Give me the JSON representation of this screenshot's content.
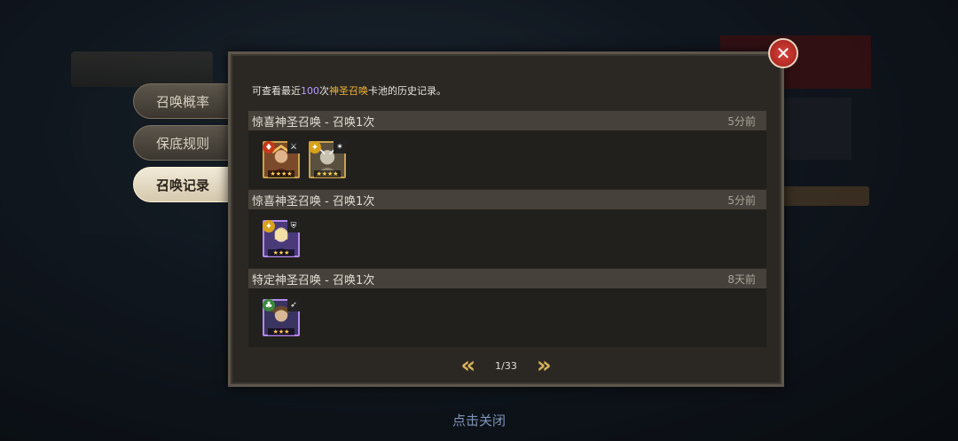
{
  "tabs": [
    {
      "label": "召唤概率",
      "active": false
    },
    {
      "label": "保底规则",
      "active": false
    },
    {
      "label": "召唤记录",
      "active": true
    }
  ],
  "intro": {
    "prefix": "可查看最近",
    "count": "100",
    "mid": "次",
    "pool": "神圣召唤",
    "suffix": "卡池的历史记录。"
  },
  "records": [
    {
      "title": "惊喜神圣召唤 - 召唤1次",
      "time": "5分前",
      "heroes": [
        {
          "frame": "gold",
          "element_icon": "fire-element-icon",
          "class_icon": "sword-class-icon",
          "stars": 4
        },
        {
          "frame": "gold",
          "element_icon": "light-element-icon",
          "class_icon": "star-class-icon",
          "stars": 4
        }
      ]
    },
    {
      "title": "惊喜神圣召唤 - 召唤1次",
      "time": "5分前",
      "heroes": [
        {
          "frame": "purple",
          "element_icon": "light-element-icon",
          "class_icon": "shield-class-icon",
          "stars": 3
        }
      ]
    },
    {
      "title": "特定神圣召唤 - 召唤1次",
      "time": "8天前",
      "heroes": [
        {
          "frame": "purple",
          "element_icon": "earth-element-icon",
          "class_icon": "bow-class-icon",
          "stars": 3
        }
      ]
    }
  ],
  "pager": {
    "label": "1/33"
  },
  "close_hint": "点击关闭",
  "colors": {
    "highlight_count": "#b89cff",
    "highlight_pool": "#f0b23a",
    "accent_gold": "#d9b15c"
  }
}
